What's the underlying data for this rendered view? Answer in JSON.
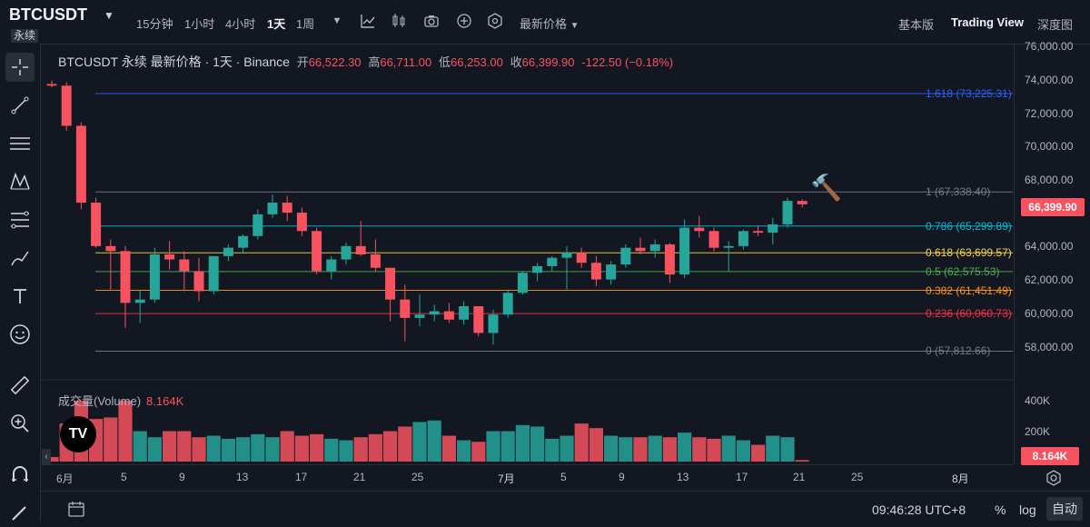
{
  "header": {
    "symbol": "BTCUSDT",
    "perp_badge": "永续",
    "timeframes": [
      "15分钟",
      "1小时",
      "4小时",
      "1天",
      "1周"
    ],
    "active_timeframe": "1天",
    "price_type": "最新价格",
    "views": [
      "基本版",
      "Trading View",
      "深度图"
    ],
    "active_view": "Trading View"
  },
  "legend": {
    "title": "BTCUSDT 永续 最新价格 · 1天 · Binance",
    "open_label": "开",
    "open": "66,522.30",
    "high_label": "高",
    "high": "66,711.00",
    "low_label": "低",
    "low": "66,253.00",
    "close_label": "收",
    "close": "66,399.90",
    "change": "-122.50 (−0.18%)"
  },
  "volume_legend": {
    "label": "成交量(Volume)",
    "value": "8.164K"
  },
  "price_axis": [
    "76,000.00",
    "74,000.00",
    "72,000.00",
    "70,000.00",
    "68,000.00",
    "66,000.00",
    "64,000.00",
    "62,000.00",
    "60,000.00",
    "58,000.00"
  ],
  "volume_axis": [
    "400K",
    "200K"
  ],
  "last_price_tag": "66,399.90",
  "volume_tag": "8.164K",
  "time_axis": [
    "6月",
    "5",
    "9",
    "13",
    "17",
    "21",
    "25",
    "7月",
    "5",
    "9",
    "13",
    "17",
    "21",
    "25",
    "8月"
  ],
  "fib_levels": [
    {
      "label": "1.618 (73,225.31)",
      "color": "#2962ff"
    },
    {
      "label": "1 (67,338.40)",
      "color": "#787b86"
    },
    {
      "label": "0.786 (65,299.89)",
      "color": "#00bcd4"
    },
    {
      "label": "0.618 (63,699.57)",
      "color": "#f5d547"
    },
    {
      "label": "0.5 (62,575.53)",
      "color": "#4caf50"
    },
    {
      "label": "0.382 (61,451.49)",
      "color": "#ff9800"
    },
    {
      "label": "0.236 (60,060.73)",
      "color": "#f23645"
    },
    {
      "label": "0 (57,812.66)",
      "color": "#787b86"
    }
  ],
  "bottom": {
    "clock": "09:46:28 UTC+8",
    "percent": "%",
    "log": "log",
    "auto": "自动"
  },
  "colors": {
    "up": "#26a69a",
    "down": "#f7525f",
    "bg": "#131722"
  },
  "chart_data": {
    "type": "candlestick",
    "ylim": [
      57000,
      76500
    ],
    "candles": [
      {
        "o": 73800,
        "h": 74000,
        "l": 73600,
        "c": 73700
      },
      {
        "o": 73700,
        "h": 73900,
        "l": 71000,
        "c": 71300
      },
      {
        "o": 71300,
        "h": 71500,
        "l": 66300,
        "c": 66700
      },
      {
        "o": 66700,
        "h": 67000,
        "l": 64000,
        "c": 64100
      },
      {
        "o": 64100,
        "h": 64500,
        "l": 61500,
        "c": 63800
      },
      {
        "o": 63800,
        "h": 64100,
        "l": 59200,
        "c": 60700
      },
      {
        "o": 60700,
        "h": 61500,
        "l": 59500,
        "c": 60900
      },
      {
        "o": 60900,
        "h": 64000,
        "l": 60700,
        "c": 63600
      },
      {
        "o": 63600,
        "h": 64400,
        "l": 62700,
        "c": 63300
      },
      {
        "o": 63300,
        "h": 63800,
        "l": 61400,
        "c": 62600
      },
      {
        "o": 62600,
        "h": 63400,
        "l": 60800,
        "c": 61400
      },
      {
        "o": 61400,
        "h": 63400,
        "l": 61200,
        "c": 63500
      },
      {
        "o": 63500,
        "h": 64200,
        "l": 63200,
        "c": 64000
      },
      {
        "o": 64000,
        "h": 64800,
        "l": 63700,
        "c": 64700
      },
      {
        "o": 64700,
        "h": 66300,
        "l": 64500,
        "c": 66000
      },
      {
        "o": 66000,
        "h": 67200,
        "l": 65800,
        "c": 66700
      },
      {
        "o": 66700,
        "h": 67100,
        "l": 65600,
        "c": 66100
      },
      {
        "o": 66100,
        "h": 66400,
        "l": 64700,
        "c": 65000
      },
      {
        "o": 65000,
        "h": 65200,
        "l": 62400,
        "c": 62600
      },
      {
        "o": 62600,
        "h": 63500,
        "l": 62100,
        "c": 63300
      },
      {
        "o": 63300,
        "h": 64300,
        "l": 63000,
        "c": 64100
      },
      {
        "o": 64100,
        "h": 65600,
        "l": 63500,
        "c": 63600
      },
      {
        "o": 63600,
        "h": 64500,
        "l": 62600,
        "c": 62800
      },
      {
        "o": 62800,
        "h": 62800,
        "l": 59600,
        "c": 60900
      },
      {
        "o": 60900,
        "h": 61800,
        "l": 58400,
        "c": 59800
      },
      {
        "o": 59800,
        "h": 61200,
        "l": 59300,
        "c": 60000
      },
      {
        "o": 60000,
        "h": 60600,
        "l": 59600,
        "c": 60200
      },
      {
        "o": 60200,
        "h": 60700,
        "l": 59500,
        "c": 59700
      },
      {
        "o": 59700,
        "h": 60800,
        "l": 59400,
        "c": 60500
      },
      {
        "o": 60500,
        "h": 60500,
        "l": 58700,
        "c": 58900
      },
      {
        "o": 58900,
        "h": 60300,
        "l": 58200,
        "c": 60000
      },
      {
        "o": 60000,
        "h": 61500,
        "l": 59800,
        "c": 61300
      },
      {
        "o": 61300,
        "h": 62600,
        "l": 61200,
        "c": 62500
      },
      {
        "o": 62500,
        "h": 63100,
        "l": 62000,
        "c": 62900
      },
      {
        "o": 62900,
        "h": 63500,
        "l": 62600,
        "c": 63400
      },
      {
        "o": 63400,
        "h": 64100,
        "l": 61500,
        "c": 63700
      },
      {
        "o": 63700,
        "h": 64000,
        "l": 62800,
        "c": 63100
      },
      {
        "o": 63100,
        "h": 63500,
        "l": 61700,
        "c": 62100
      },
      {
        "o": 62100,
        "h": 63200,
        "l": 61800,
        "c": 63000
      },
      {
        "o": 63000,
        "h": 64200,
        "l": 62800,
        "c": 64000
      },
      {
        "o": 64000,
        "h": 64600,
        "l": 63600,
        "c": 63800
      },
      {
        "o": 63800,
        "h": 64500,
        "l": 63400,
        "c": 64200
      },
      {
        "o": 64200,
        "h": 64300,
        "l": 61900,
        "c": 62400
      },
      {
        "o": 62400,
        "h": 65700,
        "l": 62200,
        "c": 65200
      },
      {
        "o": 65200,
        "h": 65900,
        "l": 64600,
        "c": 65000
      },
      {
        "o": 65000,
        "h": 65200,
        "l": 63800,
        "c": 64000
      },
      {
        "o": 64000,
        "h": 64400,
        "l": 62600,
        "c": 64100
      },
      {
        "o": 64100,
        "h": 65100,
        "l": 63900,
        "c": 65000
      },
      {
        "o": 65000,
        "h": 65300,
        "l": 64700,
        "c": 64900
      },
      {
        "o": 64900,
        "h": 65800,
        "l": 64200,
        "c": 65400
      },
      {
        "o": 65400,
        "h": 67000,
        "l": 65200,
        "c": 66800
      },
      {
        "o": 66800,
        "h": 66900,
        "l": 66400,
        "c": 66600
      }
    ],
    "volume": [
      30,
      250,
      400,
      280,
      290,
      400,
      200,
      160,
      200,
      200,
      160,
      170,
      150,
      160,
      180,
      160,
      200,
      170,
      180,
      150,
      140,
      160,
      180,
      200,
      230,
      260,
      270,
      170,
      140,
      130,
      200,
      200,
      240,
      230,
      150,
      170,
      250,
      220,
      170,
      160,
      160,
      170,
      160,
      190,
      160,
      150,
      170,
      140,
      110,
      170,
      160,
      10
    ]
  }
}
